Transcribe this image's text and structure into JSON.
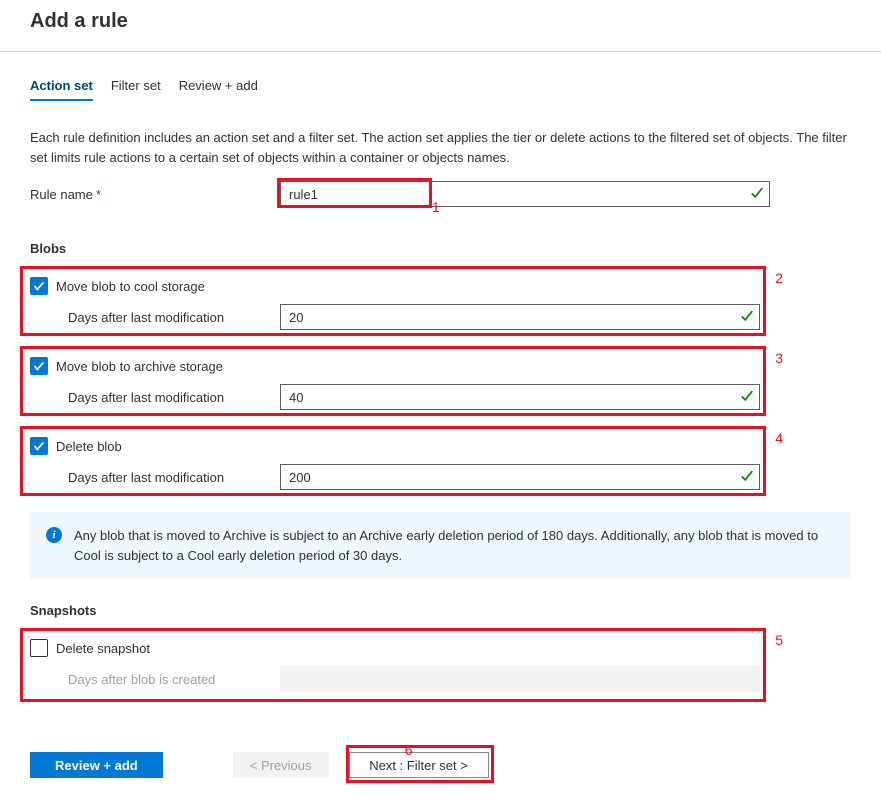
{
  "header": {
    "title": "Add a rule"
  },
  "tabs": [
    {
      "label": "Action set",
      "active": true
    },
    {
      "label": "Filter set",
      "active": false
    },
    {
      "label": "Review + add",
      "active": false
    }
  ],
  "description": "Each rule definition includes an action set and a filter set. The action set applies the tier or delete actions to the filtered set of objects. The filter set limits rule actions to a certain set of objects within a container or objects names.",
  "rule_name": {
    "label": "Rule name",
    "value": "rule1",
    "required": true
  },
  "sections": {
    "blobs": {
      "title": "Blobs",
      "items": [
        {
          "label": "Move blob to cool storage",
          "checked": true,
          "sub_label": "Days after last modification",
          "value": "20"
        },
        {
          "label": "Move blob to archive storage",
          "checked": true,
          "sub_label": "Days after last modification",
          "value": "40"
        },
        {
          "label": "Delete blob",
          "checked": true,
          "sub_label": "Days after last modification",
          "value": "200"
        }
      ]
    },
    "snapshots": {
      "title": "Snapshots",
      "items": [
        {
          "label": "Delete snapshot",
          "checked": false,
          "sub_label": "Days after blob is created",
          "value": ""
        }
      ]
    }
  },
  "info_text": "Any blob that is moved to Archive is subject to an Archive early deletion period of 180 days. Additionally, any blob that is moved to Cool is subject to a Cool early deletion period of 30 days.",
  "footer": {
    "review_add": "Review + add",
    "previous": "< Previous",
    "next": "Next : Filter set >"
  },
  "annotations": [
    "1",
    "2",
    "3",
    "4",
    "5",
    "6"
  ]
}
